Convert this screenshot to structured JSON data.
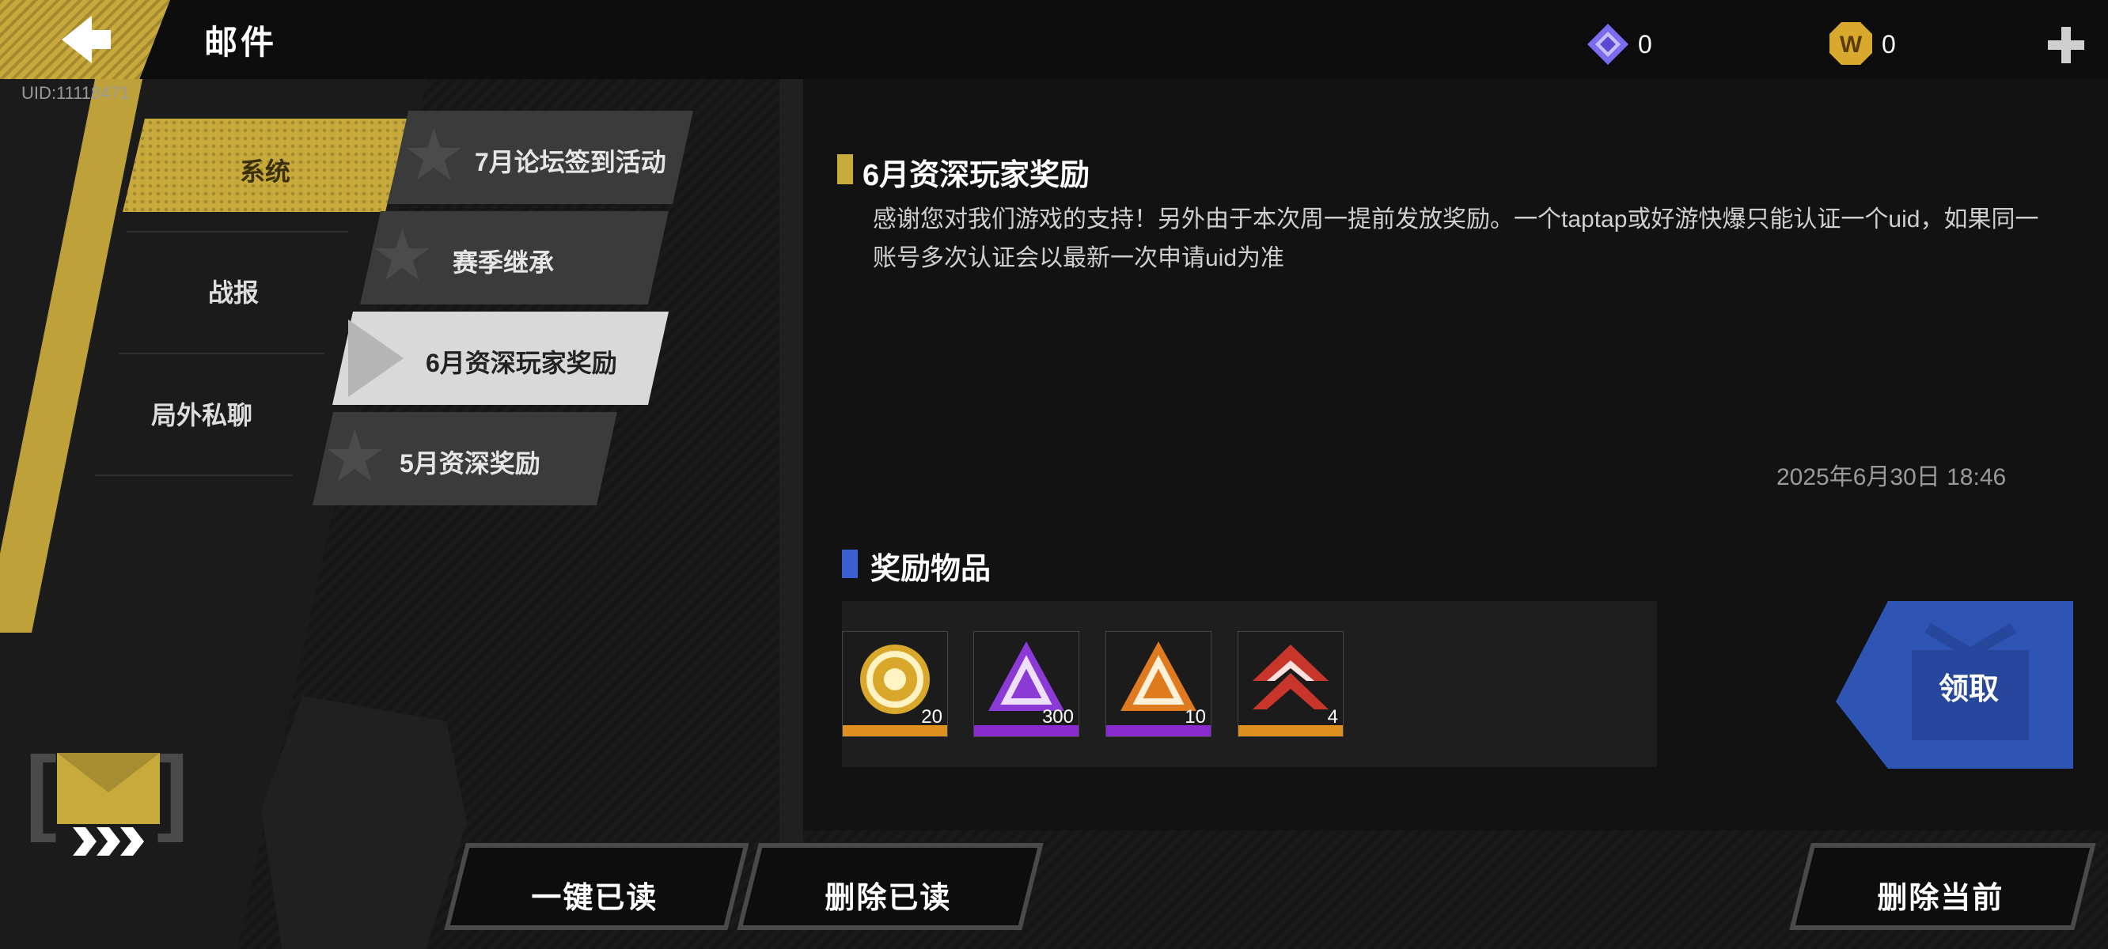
{
  "header": {
    "title": "邮件",
    "uid": "UID:11118471",
    "currency_gem_value": "0",
    "currency_coin_value": "0"
  },
  "categories": [
    {
      "label": "系统",
      "active": true
    },
    {
      "label": "战报",
      "active": false
    },
    {
      "label": "局外私聊",
      "active": false
    }
  ],
  "mail_list": [
    {
      "label": "7月论坛签到活动",
      "active": false
    },
    {
      "label": "赛季继承",
      "active": false
    },
    {
      "label": "6月资深玩家奖励",
      "active": true
    },
    {
      "label": "5月资深奖励",
      "active": false
    }
  ],
  "mail": {
    "title": "6月资深玩家奖励",
    "body": "感谢您对我们游戏的支持！另外由于本次周一提前发放奖励。一个taptap或好游快爆只能认证一个uid，如果同一账号多次认证会以最新一次申请uid为准",
    "date": "2025年6月30日  18:46"
  },
  "rewards": {
    "title": "奖励物品",
    "items": [
      {
        "icon": "gold-coin-emblem-icon",
        "count": "20",
        "rarity_color": "#e0901e"
      },
      {
        "icon": "purple-triangle-icon",
        "count": "300",
        "rarity_color": "#8a2bd0"
      },
      {
        "icon": "orange-triangle-icon",
        "count": "10",
        "rarity_color": "#8a2bd0"
      },
      {
        "icon": "red-chevron-icon",
        "count": "4",
        "rarity_color": "#e0901e"
      }
    ],
    "claim_label": "领取"
  },
  "buttons": {
    "read_all": "一键已读",
    "delete_read": "删除已读",
    "delete_current": "删除当前"
  },
  "colors": {
    "accent_gold": "#c8a93c",
    "claim_blue": "#2f55b4",
    "reward_bar_blue": "#3a5fcf"
  }
}
